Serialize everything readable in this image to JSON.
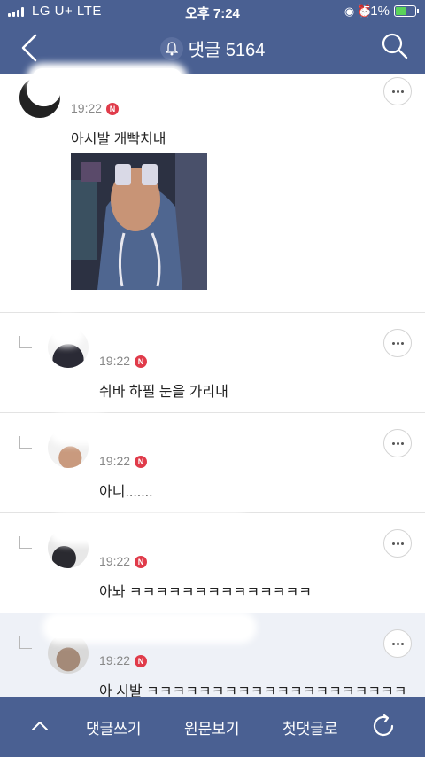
{
  "status": {
    "carrier": "LG U+  LTE",
    "time": "오후 7:24",
    "battery_pct": "51%"
  },
  "header": {
    "title": "댓글 5164",
    "icons": [
      "back-arrow-icon",
      "bell-icon",
      "search-icon"
    ]
  },
  "comments": [
    {
      "time": "19:22",
      "badge": "N",
      "text": "아시발 개빡치내",
      "has_image": true
    },
    {
      "time": "19:22",
      "badge": "N",
      "text": "쉬바 하필 눈을 가리내",
      "reply": true
    },
    {
      "time": "19:22",
      "badge": "N",
      "text": "아니.......",
      "reply": true
    },
    {
      "time": "19:22",
      "badge": "N",
      "text": "아놔 ㅋㅋㅋㅋㅋㅋㅋㅋㅋㅋㅋㅋㅋㅋ",
      "reply": true
    },
    {
      "time": "19:22",
      "badge": "N",
      "text": "아 시발 ㅋㅋㅋㅋㅋㅋㅋㅋㅋㅋㅋㅋㅋㅋㅋㅋㅋㅋㅋㅋ",
      "reply": true
    }
  ],
  "bottombar": {
    "write": "댓글쓰기",
    "original": "원문보기",
    "first": "첫댓글로"
  },
  "colors": {
    "bar": "#4a6092",
    "badge": "#e03b4a",
    "highlight": "#eef1f7"
  }
}
